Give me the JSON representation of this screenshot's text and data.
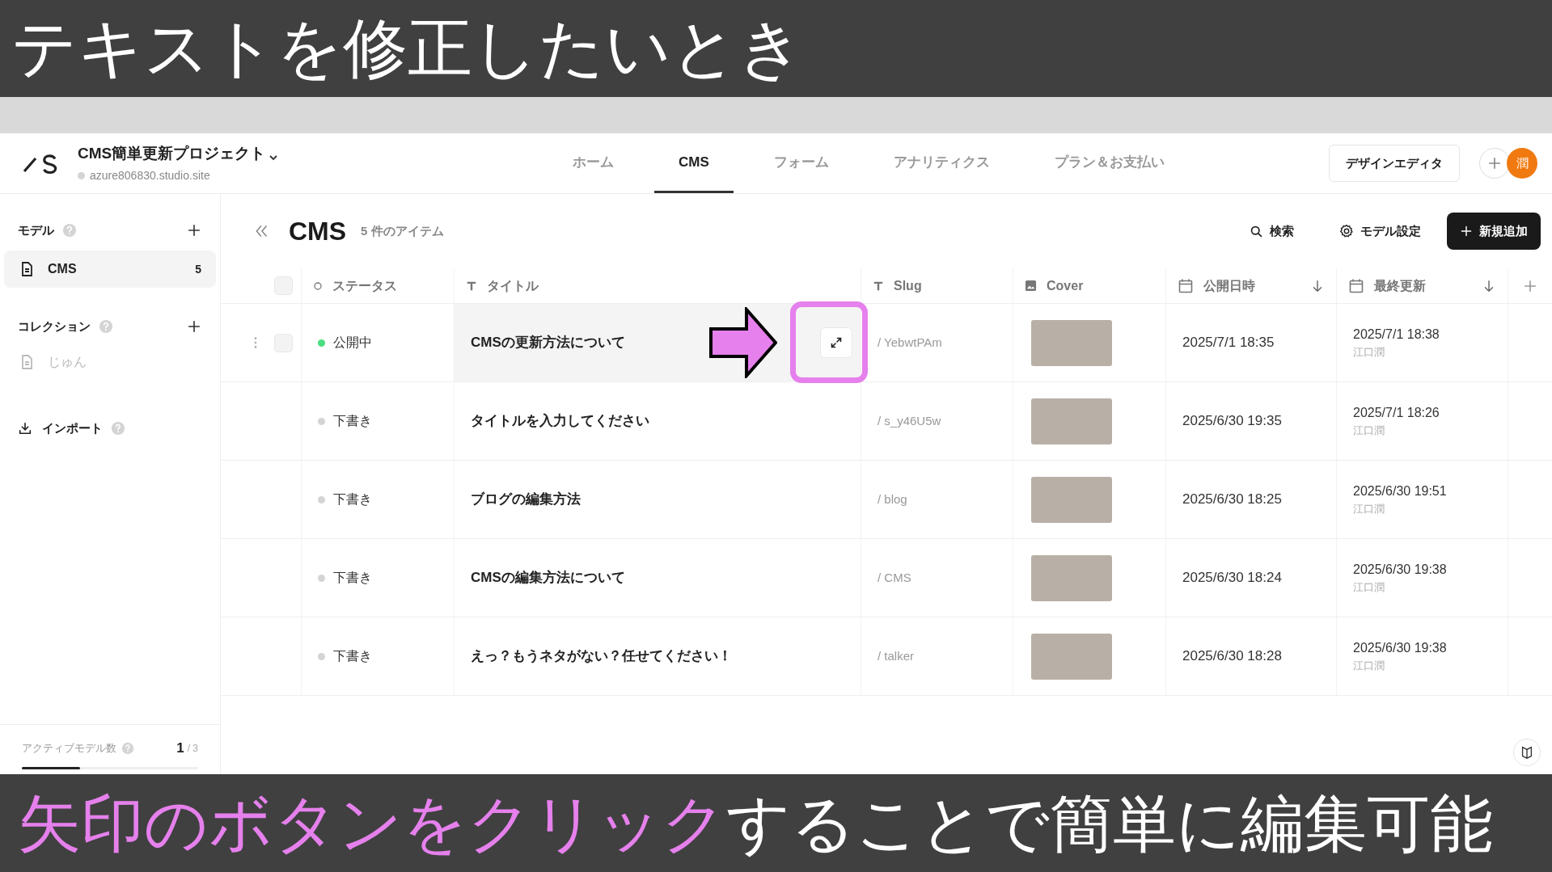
{
  "caption_top": "テキストを修正したいとき",
  "project": {
    "name": "CMS簡単更新プロジェクト",
    "url": "azure806830.studio.site"
  },
  "nav": [
    {
      "label": "ホーム",
      "selected": false
    },
    {
      "label": "CMS",
      "selected": true
    },
    {
      "label": "フォーム",
      "selected": false
    },
    {
      "label": "アナリティクス",
      "selected": false
    },
    {
      "label": "プラン＆お支払い",
      "selected": false
    }
  ],
  "design_editor": "デザインエディタ",
  "avatar": "潤",
  "sidebar": {
    "models_heading": "モデル",
    "models": [
      {
        "label": "CMS",
        "count": "5",
        "selected": true
      }
    ],
    "collections_heading": "コレクション",
    "collections": [
      {
        "label": "じゅん",
        "selected": false
      }
    ],
    "import": "インポート",
    "active_models": {
      "label": "アクティブモデル数",
      "count": "1",
      "total": "/ 3",
      "level": 0.33
    }
  },
  "main": {
    "title": "CMS",
    "count": "5 件のアイテム",
    "search": "検索",
    "model_settings": "モデル設定",
    "add": "新規追加"
  },
  "table": {
    "select_all_checked": false,
    "columns": [
      {
        "label": "ステータス",
        "kind": "status",
        "sorted": false
      },
      {
        "label": "タイトル",
        "kind": "text",
        "sorted": false
      },
      {
        "label": "Slug",
        "kind": "text",
        "sorted": false
      },
      {
        "label": "Cover",
        "kind": "image",
        "sorted": false
      },
      {
        "label": "公開日時",
        "kind": "date",
        "sorted": true
      },
      {
        "label": "最終更新",
        "kind": "date",
        "sorted": true
      }
    ],
    "rows": [
      {
        "status": "公開中",
        "color": "#4ade80",
        "title": "CMSの更新方法について",
        "slug": "/ YebwtPAm",
        "published": "2025/7/1 18:35",
        "updated": "2025/7/1 18:38",
        "updated_by": "江口潤",
        "hovered": true,
        "checked": false
      },
      {
        "status": "下書き",
        "color": "#d4d4d4",
        "title": "タイトルを入力してください",
        "slug": "/ s_y46U5w",
        "published": "2025/6/30 19:35",
        "updated": "2025/7/1 18:26",
        "updated_by": "江口潤",
        "hovered": false
      },
      {
        "status": "下書き",
        "color": "#d4d4d4",
        "title": "ブログの編集方法",
        "slug": "/ blog",
        "published": "2025/6/30 18:25",
        "updated": "2025/6/30 19:51",
        "updated_by": "江口潤",
        "hovered": false
      },
      {
        "status": "下書き",
        "color": "#d4d4d4",
        "title": "CMSの編集方法について",
        "slug": "/ CMS",
        "published": "2025/6/30 18:24",
        "updated": "2025/6/30 19:38",
        "updated_by": "江口潤",
        "hovered": false
      },
      {
        "status": "下書き",
        "color": "#d4d4d4",
        "title": "えっ？もうネタがない？任せてください！",
        "slug": "/ talker",
        "published": "2025/6/30 18:28",
        "updated": "2025/6/30 19:38",
        "updated_by": "江口潤",
        "hovered": false
      }
    ]
  },
  "caption_bottom": [
    {
      "text": "矢印のボタンをクリック",
      "color": "#e580ec"
    },
    {
      "text": "することで簡単に編集可能",
      "color": "#ffffff"
    }
  ]
}
